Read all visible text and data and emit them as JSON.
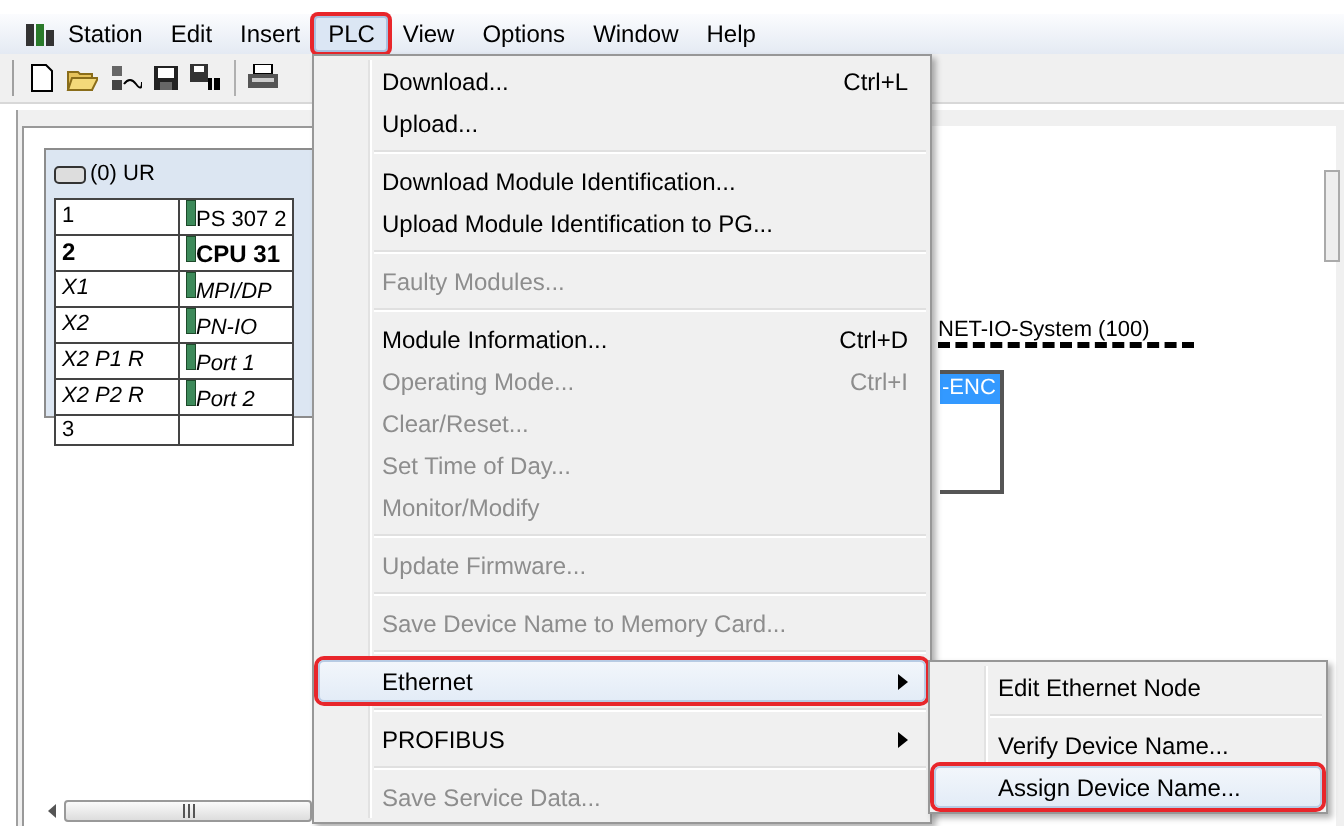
{
  "menubar": [
    {
      "label": "Station",
      "selected": false,
      "highlighted": false
    },
    {
      "label": "Edit",
      "selected": false,
      "highlighted": false
    },
    {
      "label": "Insert",
      "selected": false,
      "highlighted": false
    },
    {
      "label": "PLC",
      "selected": true,
      "highlighted": true
    },
    {
      "label": "View",
      "selected": false,
      "highlighted": false
    },
    {
      "label": "Options",
      "selected": false,
      "highlighted": false
    },
    {
      "label": "Window",
      "selected": false,
      "highlighted": false
    },
    {
      "label": "Help",
      "selected": false,
      "highlighted": false
    }
  ],
  "rack": {
    "title": "(0) UR",
    "rows": [
      {
        "slot": "1",
        "module": "PS 307 2",
        "kind": "module"
      },
      {
        "slot": "2",
        "module": "CPU 31",
        "kind": "cpu"
      },
      {
        "slot": "X1",
        "module": "MPI/DP",
        "kind": "interface"
      },
      {
        "slot": "X2",
        "module": "PN-IO",
        "kind": "interface"
      },
      {
        "slot": "X2 P1 R",
        "module": "Port 1",
        "kind": "interface"
      },
      {
        "slot": "X2 P2 R",
        "module": "Port 2",
        "kind": "interface"
      },
      {
        "slot": "3",
        "module": "",
        "kind": "empty"
      }
    ]
  },
  "network": {
    "label": "NET-IO-System (100)",
    "device": "-ENC"
  },
  "plc_menu": [
    {
      "kind": "item",
      "label": "Download...",
      "shortcut": "Ctrl+L",
      "disabled": false,
      "submenu": false,
      "selected": false,
      "highlighted": false
    },
    {
      "kind": "item",
      "label": "Upload...",
      "disabled": false,
      "submenu": false,
      "selected": false,
      "highlighted": false
    },
    {
      "kind": "separator"
    },
    {
      "kind": "item",
      "label": "Download Module Identification...",
      "disabled": false,
      "submenu": false,
      "selected": false,
      "highlighted": false
    },
    {
      "kind": "item",
      "label": "Upload Module Identification to PG...",
      "disabled": false,
      "submenu": false,
      "selected": false,
      "highlighted": false
    },
    {
      "kind": "separator"
    },
    {
      "kind": "item",
      "label": "Faulty Modules...",
      "disabled": true,
      "submenu": false,
      "selected": false,
      "highlighted": false
    },
    {
      "kind": "separator"
    },
    {
      "kind": "item",
      "label": "Module Information...",
      "shortcut": "Ctrl+D",
      "disabled": false,
      "submenu": false,
      "selected": false,
      "highlighted": false
    },
    {
      "kind": "item",
      "label": "Operating Mode...",
      "shortcut": "Ctrl+I",
      "disabled": true,
      "submenu": false,
      "selected": false,
      "highlighted": false
    },
    {
      "kind": "item",
      "label": "Clear/Reset...",
      "disabled": true,
      "submenu": false,
      "selected": false,
      "highlighted": false
    },
    {
      "kind": "item",
      "label": "Set Time of Day...",
      "disabled": true,
      "submenu": false,
      "selected": false,
      "highlighted": false
    },
    {
      "kind": "item",
      "label": "Monitor/Modify",
      "disabled": true,
      "submenu": false,
      "selected": false,
      "highlighted": false
    },
    {
      "kind": "separator"
    },
    {
      "kind": "item",
      "label": "Update Firmware...",
      "disabled": true,
      "submenu": false,
      "selected": false,
      "highlighted": false
    },
    {
      "kind": "separator"
    },
    {
      "kind": "item",
      "label": "Save Device Name to Memory Card...",
      "disabled": true,
      "submenu": false,
      "selected": false,
      "highlighted": false
    },
    {
      "kind": "separator"
    },
    {
      "kind": "item",
      "label": "Ethernet",
      "disabled": false,
      "submenu": true,
      "selected": true,
      "highlighted": true
    },
    {
      "kind": "separator"
    },
    {
      "kind": "item",
      "label": "PROFIBUS",
      "disabled": false,
      "submenu": true,
      "selected": false,
      "highlighted": false
    },
    {
      "kind": "separator"
    },
    {
      "kind": "item",
      "label": "Save Service Data...",
      "disabled": true,
      "submenu": false,
      "selected": false,
      "highlighted": false
    }
  ],
  "ethernet_menu": [
    {
      "kind": "item",
      "label": "Edit Ethernet Node",
      "disabled": false,
      "submenu": false,
      "selected": false,
      "highlighted": false
    },
    {
      "kind": "separator"
    },
    {
      "kind": "item",
      "label": "Verify Device Name...",
      "disabled": false,
      "submenu": false,
      "selected": false,
      "highlighted": false
    },
    {
      "kind": "item",
      "label": "Assign Device Name...",
      "disabled": false,
      "submenu": false,
      "selected": true,
      "highlighted": true
    }
  ]
}
